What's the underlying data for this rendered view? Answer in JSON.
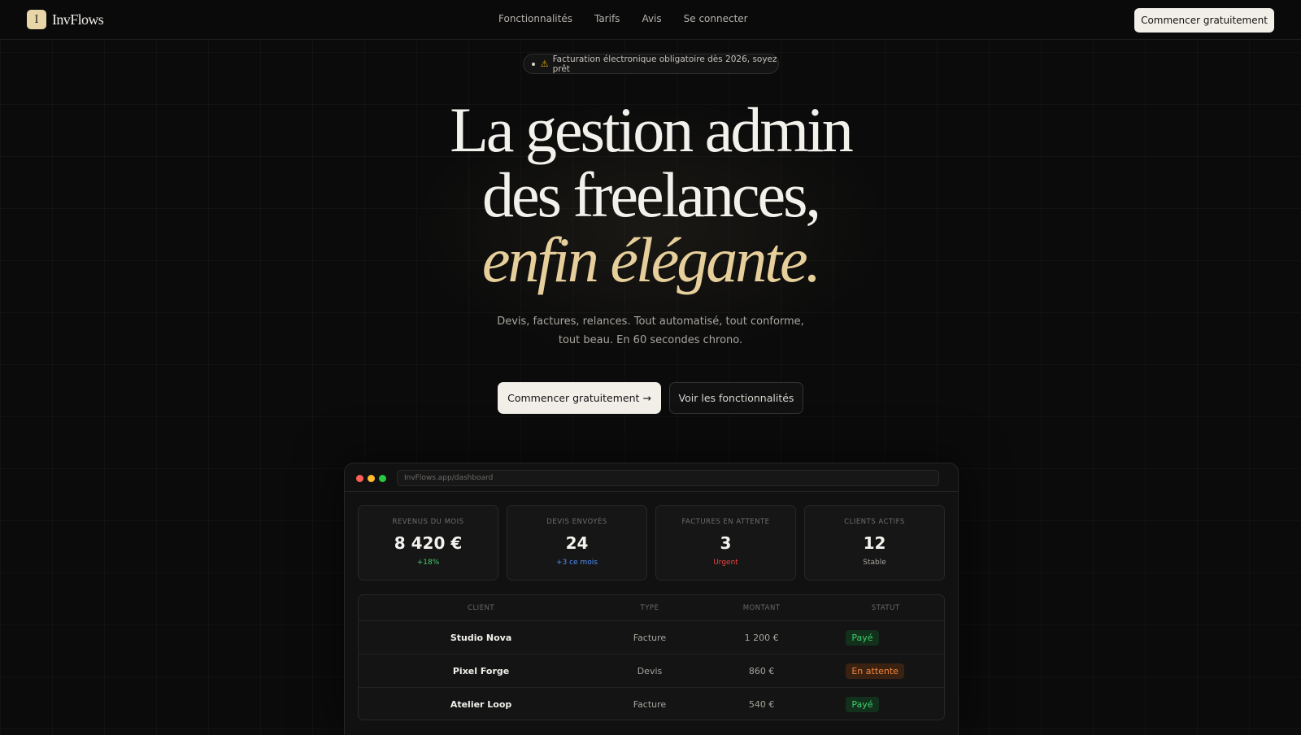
{
  "nav": {
    "logo_mark": "I",
    "logo_text": "InvFlows",
    "links": [
      "Fonctionnalités",
      "Tarifs",
      "Avis",
      "Se connecter"
    ],
    "cta": "Commencer gratuitement"
  },
  "banner": {
    "icon": "warning-icon",
    "warn_glyph": "⚠",
    "text": "Facturation électronique obligatoire dès 2026, soyez prêt"
  },
  "hero": {
    "line1": "La gestion admin",
    "line2": "des freelances,",
    "line3": "enfin élégante.",
    "subtitle": "Devis, factures, relances. Tout automatisé, tout conforme, tout beau. En 60 secondes chrono.",
    "primary_cta": "Commencer gratuitement →",
    "secondary_cta": "Voir les fonctionnalités"
  },
  "dashboard": {
    "url": "InvFlows.app/dashboard",
    "stats": [
      {
        "label": "REVENUS DU MOIS",
        "value": "8 420 €",
        "note": "+18%",
        "note_color": "#3ecf6a"
      },
      {
        "label": "DEVIS ENVOYÉS",
        "value": "24",
        "note": "+3 ce mois",
        "note_color": "#4f8ff7"
      },
      {
        "label": "FACTURES EN ATTENTE",
        "value": "3",
        "note": "Urgent",
        "note_color": "#ef4444"
      },
      {
        "label": "CLIENTS ACTIFS",
        "value": "12",
        "note": "Stable",
        "note_color": "#a8a5a0"
      }
    ],
    "table": {
      "headers": [
        "CLIENT",
        "TYPE",
        "MONTANT",
        "STATUT"
      ],
      "rows": [
        {
          "client": "Studio Nova",
          "type": "Facture",
          "amount": "1 200 €",
          "status": "Payé",
          "status_color": "#3ecf6a",
          "status_bg": "#12301c"
        },
        {
          "client": "Pixel Forge",
          "type": "Devis",
          "amount": "860 €",
          "status": "En attente",
          "status_color": "#f2853a",
          "status_bg": "#3a2212"
        },
        {
          "client": "Atelier Loop",
          "type": "Facture",
          "amount": "540 €",
          "status": "Payé",
          "status_color": "#3ecf6a",
          "status_bg": "#12301c"
        }
      ]
    }
  }
}
